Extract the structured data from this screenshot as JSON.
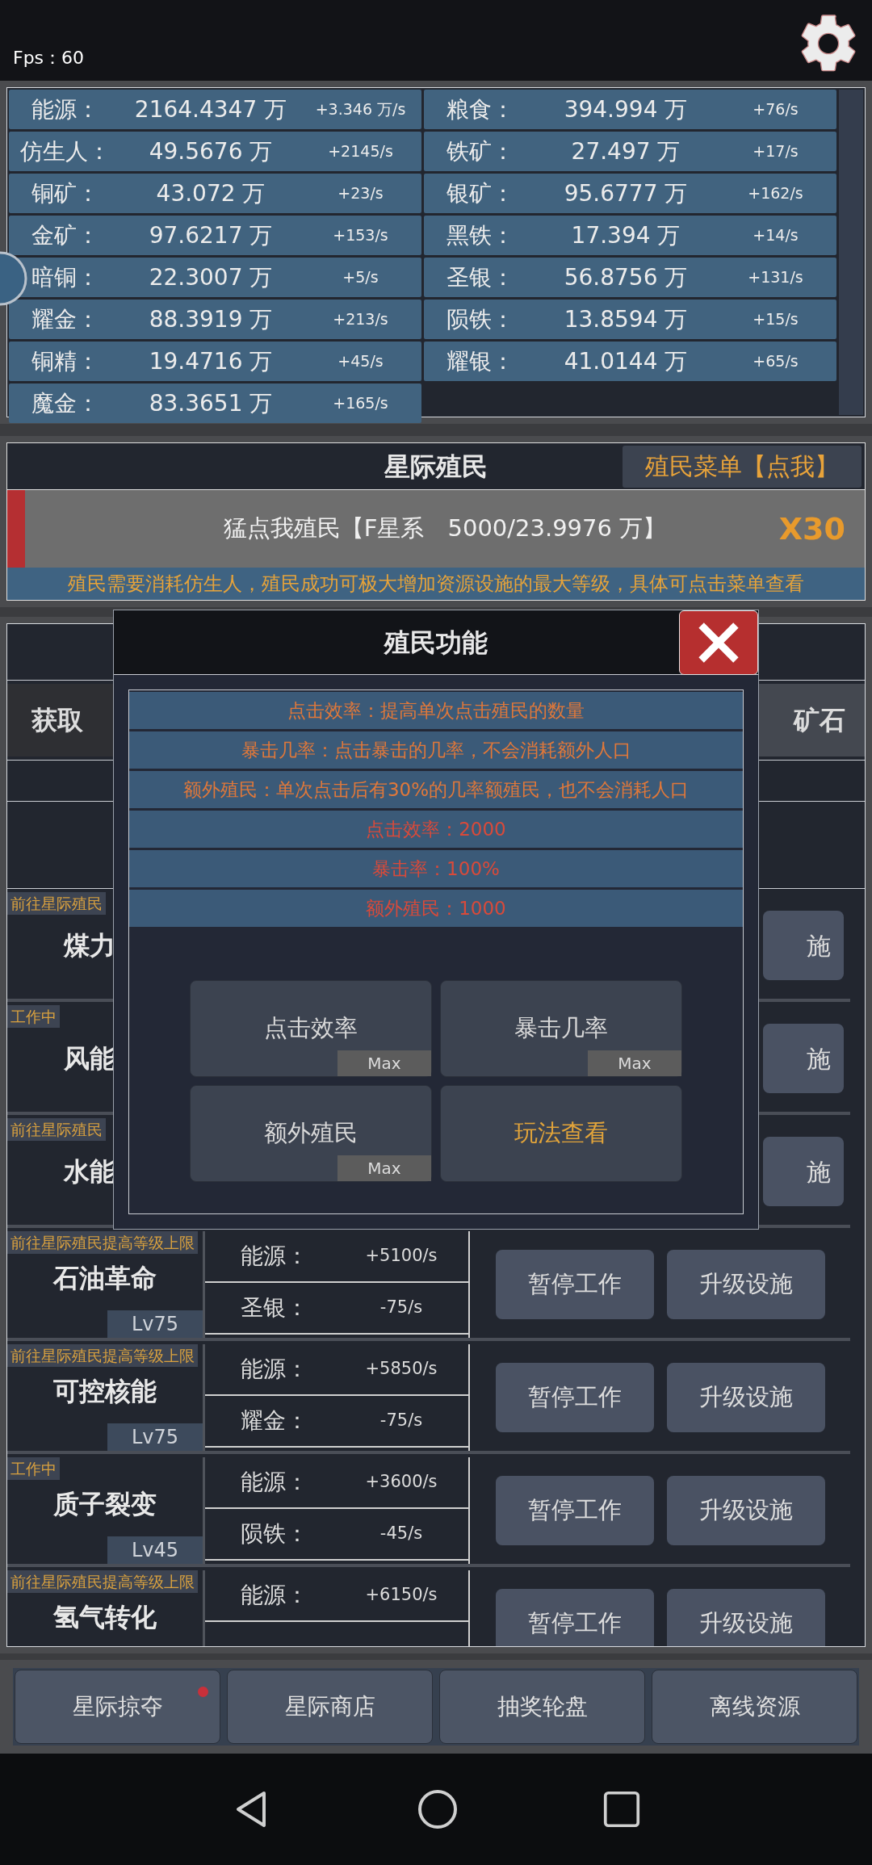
{
  "fps": "Fps：60",
  "resources": [
    {
      "name": "能源：",
      "amount": "2164.4347 万",
      "rate": "+3.346 万/s"
    },
    {
      "name": "粮食：",
      "amount": "394.994 万",
      "rate": "+76/s"
    },
    {
      "name": "仿生人：",
      "amount": "49.5676 万",
      "rate": "+2145/s"
    },
    {
      "name": "铁矿：",
      "amount": "27.497 万",
      "rate": "+17/s"
    },
    {
      "name": "铜矿：",
      "amount": "43.072 万",
      "rate": "+23/s"
    },
    {
      "name": "银矿：",
      "amount": "95.6777 万",
      "rate": "+162/s"
    },
    {
      "name": "金矿：",
      "amount": "97.6217 万",
      "rate": "+153/s"
    },
    {
      "name": "黑铁：",
      "amount": "17.394 万",
      "rate": "+14/s"
    },
    {
      "name": "暗铜：",
      "amount": "22.3007 万",
      "rate": "+5/s"
    },
    {
      "name": "圣银：",
      "amount": "56.8756 万",
      "rate": "+131/s"
    },
    {
      "name": "耀金：",
      "amount": "88.3919 万",
      "rate": "+213/s"
    },
    {
      "name": "陨铁：",
      "amount": "13.8594 万",
      "rate": "+15/s"
    },
    {
      "name": "铜精：",
      "amount": "19.4716 万",
      "rate": "+45/s"
    },
    {
      "name": "耀银：",
      "amount": "41.0144 万",
      "rate": "+65/s"
    },
    {
      "name": "魔金：",
      "amount": "83.3651 万",
      "rate": "+165/s"
    }
  ],
  "colonize": {
    "title": "星际殖民",
    "menu_button": "殖民菜单【点我】",
    "tap_button": "猛点我殖民【F星系　5000/23.9976 万】",
    "multiplier": "X30",
    "notice": "殖民需要消耗仿生人，殖民成功可极大增加资源设施的最大等级，具体可点击菜单查看"
  },
  "behind_modal": {
    "left_button": "获取",
    "right_button": "矿石"
  },
  "facilities_covered": [
    {
      "tag": "前往星际殖民",
      "name": "煤力",
      "button": "施"
    },
    {
      "tag": "工作中",
      "name": "风能",
      "button": "施"
    },
    {
      "tag": "前往星际殖民",
      "name": "水能",
      "button": "施"
    }
  ],
  "facilities": [
    {
      "tag": "前往星际殖民提高等级上限",
      "name": "石油革命",
      "level": "Lv75",
      "outputs": [
        {
          "label": "能源：",
          "value": "+5100/s"
        },
        {
          "label": "圣银：",
          "value": "-75/s"
        }
      ],
      "buttons": [
        "暂停工作",
        "升级设施"
      ]
    },
    {
      "tag": "前往星际殖民提高等级上限",
      "name": "可控核能",
      "level": "Lv75",
      "outputs": [
        {
          "label": "能源：",
          "value": "+5850/s"
        },
        {
          "label": "耀金：",
          "value": "-75/s"
        }
      ],
      "buttons": [
        "暂停工作",
        "升级设施"
      ]
    },
    {
      "tag": "工作中",
      "name": "质子裂变",
      "level": "Lv45",
      "outputs": [
        {
          "label": "能源：",
          "value": "+3600/s"
        },
        {
          "label": "陨铁：",
          "value": "-45/s"
        }
      ],
      "buttons": [
        "暂停工作",
        "升级设施"
      ]
    },
    {
      "tag": "前往星际殖民提高等级上限",
      "name": "氢气转化",
      "outputs": [
        {
          "label": "能源：",
          "value": "+6150/s"
        }
      ],
      "buttons": [
        "暂停工作",
        "升级设施"
      ]
    }
  ],
  "modal": {
    "title": "殖民功能",
    "info": [
      {
        "kind": "description",
        "text": "点击效率：提高单次点击殖民的数量"
      },
      {
        "kind": "description",
        "text": "暴击几率：点击暴击的几率，不会消耗额外人口"
      },
      {
        "kind": "description",
        "text": "额外殖民：单次点击后有30%的几率额殖民，也不会消耗人口"
      },
      {
        "kind": "stat",
        "text": "点击效率：2000"
      },
      {
        "kind": "stat",
        "text": "暴击率：100%"
      },
      {
        "kind": "stat",
        "text": "额外殖民：1000"
      }
    ],
    "actions": [
      {
        "kind": "upgrade",
        "label": "点击效率",
        "badge": "Max"
      },
      {
        "kind": "upgrade",
        "label": "暴击几率",
        "badge": "Max"
      },
      {
        "kind": "upgrade",
        "label": "额外殖民",
        "badge": "Max"
      },
      {
        "kind": "help",
        "label": "玩法查看"
      }
    ]
  },
  "bottom_tabs": [
    {
      "label": "星际掠夺",
      "notification": true
    },
    {
      "label": "星际商店",
      "notification": false
    },
    {
      "label": "抽奖轮盘",
      "notification": false
    },
    {
      "label": "离线资源",
      "notification": false
    }
  ]
}
